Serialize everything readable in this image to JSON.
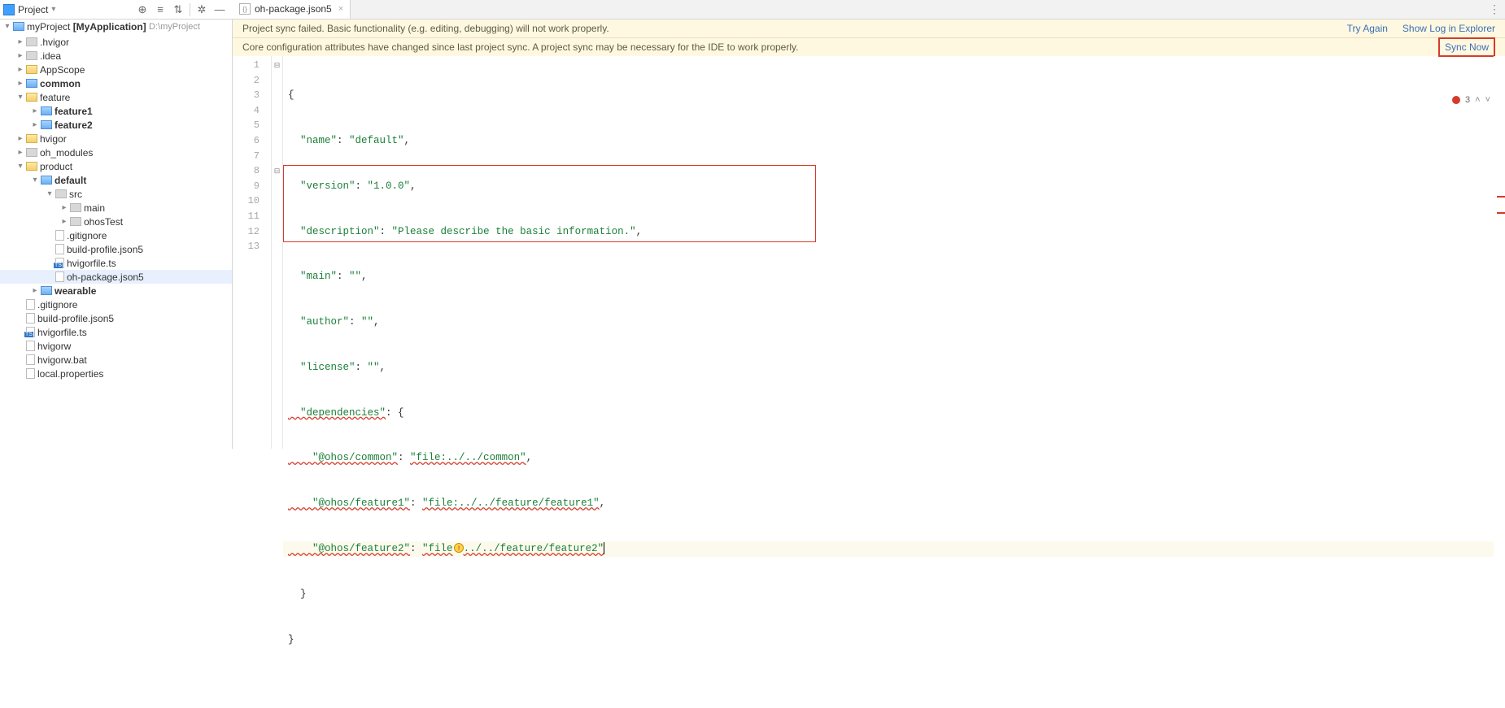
{
  "toolbar": {
    "project_label": "Project"
  },
  "tab": {
    "name": "oh-package.json5"
  },
  "tree": {
    "root_name": "myProject",
    "app_name": "[MyApplication]",
    "root_path": "D:\\myProject",
    "items": {
      "hvigor_d": ".hvigor",
      "idea": ".idea",
      "appscope": "AppScope",
      "common": "common",
      "feature": "feature",
      "feature1": "feature1",
      "feature2": "feature2",
      "hvigor": "hvigor",
      "oh_modules": "oh_modules",
      "product": "product",
      "default": "default",
      "src": "src",
      "main": "main",
      "ohosTest": "ohosTest",
      "gitignore1": ".gitignore",
      "build_profile1": "build-profile.json5",
      "hvigorfile1": "hvigorfile.ts",
      "oh_package1": "oh-package.json5",
      "wearable": "wearable",
      "gitignore2": ".gitignore",
      "build_profile2": "build-profile.json5",
      "hvigorfile2": "hvigorfile.ts",
      "hvigorw": "hvigorw",
      "hvigorw_bat": "hvigorw.bat",
      "local_props": "local.properties"
    }
  },
  "banner1": {
    "text": "Project sync failed. Basic functionality (e.g. editing, debugging) will not work properly.",
    "try_again": "Try Again",
    "show_log": "Show Log in Explorer"
  },
  "banner2": {
    "text": "Core configuration attributes have changed since last project sync. A project sync may be necessary for the IDE to work properly.",
    "sync_now": "Sync Now"
  },
  "problems": {
    "error_count": "3"
  },
  "code": {
    "l1": "{",
    "l2a": "  \"name\"",
    "l2b": ": ",
    "l2c": "\"default\"",
    "l2d": ",",
    "l3a": "  \"version\"",
    "l3b": ": ",
    "l3c": "\"1.0.0\"",
    "l3d": ",",
    "l4a": "  \"description\"",
    "l4b": ": ",
    "l4c": "\"Please describe the basic information.\"",
    "l4d": ",",
    "l5a": "  \"main\"",
    "l5b": ": ",
    "l5c": "\"\"",
    "l5d": ",",
    "l6a": "  \"author\"",
    "l6b": ": ",
    "l6c": "\"\"",
    "l6d": ",",
    "l7a": "  \"license\"",
    "l7b": ": ",
    "l7c": "\"\"",
    "l7d": ",",
    "l8a": "  \"dependencies\"",
    "l8b": ": {",
    "l9a": "    \"@ohos/common\"",
    "l9b": ": ",
    "l9c": "\"file:../../common\"",
    "l9d": ",",
    "l10a": "    \"@ohos/feature1\"",
    "l10b": ": ",
    "l10c": "\"file:../../feature/feature1\"",
    "l10d": ",",
    "l11a": "    \"@ohos/feature2\"",
    "l11b": ": ",
    "l11c_a": "\"file",
    "l11c_b": "../../feature/feature2\"",
    "l12": "  }",
    "l13": "}"
  },
  "line_numbers": [
    "1",
    "2",
    "3",
    "4",
    "5",
    "6",
    "7",
    "8",
    "9",
    "10",
    "11",
    "12",
    "13"
  ]
}
